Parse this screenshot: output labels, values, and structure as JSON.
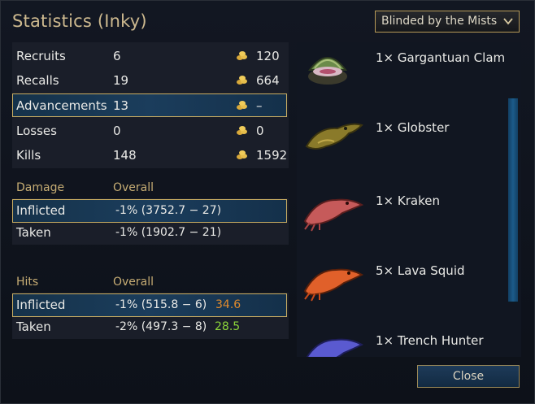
{
  "window": {
    "title": "Statistics (Inky)"
  },
  "scenario": {
    "selected": "Blinded by the Mists"
  },
  "summary_rows": [
    {
      "label": "Recruits",
      "count": "6",
      "gold": "120"
    },
    {
      "label": "Recalls",
      "count": "19",
      "gold": "664"
    },
    {
      "label": "Advancements",
      "count": "13",
      "gold": "–"
    },
    {
      "label": "Losses",
      "count": "0",
      "gold": "0"
    },
    {
      "label": "Kills",
      "count": "148",
      "gold": "1592"
    }
  ],
  "damage": {
    "header": "Damage",
    "col_header": "Overall",
    "rows": [
      {
        "label": "Inflicted",
        "value": "-1% (3752.7 − 27)"
      },
      {
        "label": "Taken",
        "value": "-1% (1902.7 − 21)"
      }
    ]
  },
  "hits": {
    "header": "Hits",
    "col_header": "Overall",
    "rows": [
      {
        "label": "Inflicted",
        "value": "-1% (515.8 − 6)",
        "extra": "34.6",
        "extra_color": "#e08a2c"
      },
      {
        "label": "Taken",
        "value": "-2% (497.3 − 8)",
        "extra": "28.5",
        "extra_color": "#8bd43a"
      }
    ]
  },
  "units": [
    {
      "label": "1× Gargantuan Clam",
      "icon": "gargantuan-clam-icon"
    },
    {
      "label": "1× Globster",
      "icon": "globster-icon"
    },
    {
      "label": "1× Kraken",
      "icon": "kraken-icon"
    },
    {
      "label": "5× Lava Squid",
      "icon": "lava-squid-icon"
    },
    {
      "label": "1× Trench Hunter",
      "icon": "trench-hunter-icon"
    }
  ],
  "buttons": {
    "close": "Close"
  },
  "colors": {
    "accent_gold": "#c9ad62",
    "selection": "#1b3d5c",
    "title": "#cdb98f"
  }
}
